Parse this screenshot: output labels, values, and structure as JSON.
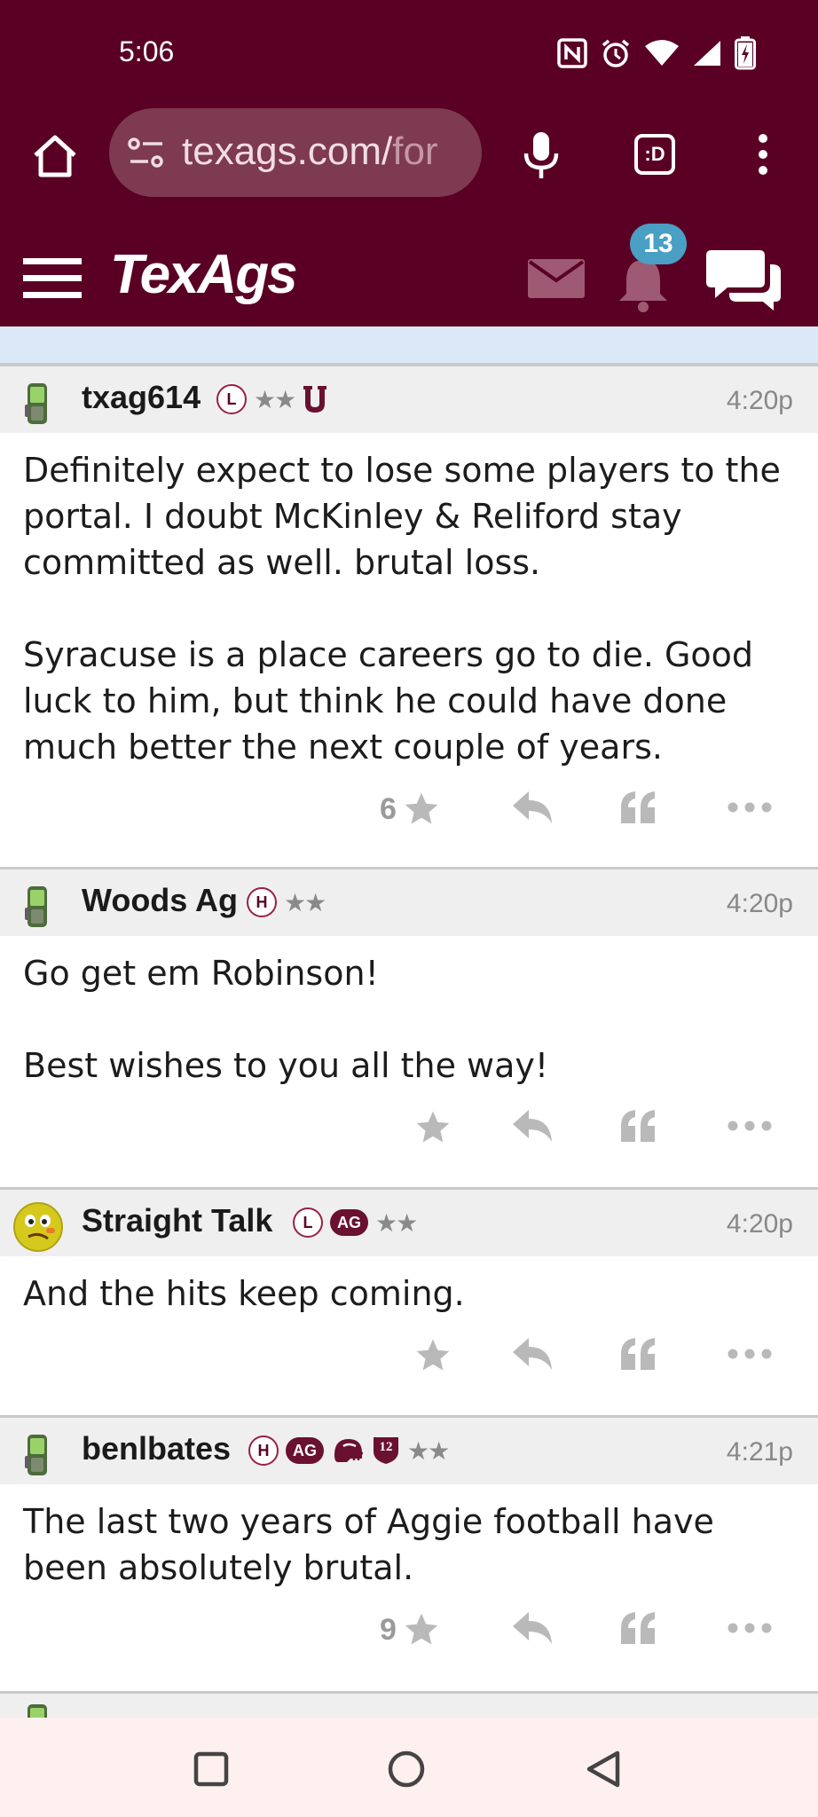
{
  "status_bar": {
    "time": "5:06",
    "icons": [
      "nfc-icon",
      "alarm-icon",
      "wifi-icon",
      "signal-icon",
      "battery-charging-icon"
    ]
  },
  "browser": {
    "url_host": "texags.com/",
    "url_rest": "for",
    "tabs_label": ":D"
  },
  "site": {
    "logo": "TexAgs",
    "notification_count": "13"
  },
  "posts": [
    {
      "username": "txag614",
      "badges": [
        "L",
        "★★"
      ],
      "time": "4:20p",
      "paragraphs": [
        "Definitely expect to lose some players to the portal. I doubt McKinley & Reliford stay committed as well. brutal loss.",
        "Syracuse is a place careers go to die. Good luck to him, but think he could have done much better the next couple of years."
      ],
      "star_count": "6"
    },
    {
      "username": "Woods Ag",
      "badges": [
        "H",
        "★★"
      ],
      "time": "4:20p",
      "paragraphs": [
        "Go get em Robinson!",
        "Best wishes to you all the way!"
      ],
      "star_count": ""
    },
    {
      "username": "Straight Talk",
      "badges": [
        "L",
        "AG",
        "★★"
      ],
      "time": "4:20p",
      "paragraphs": [
        "And the hits keep coming."
      ],
      "star_count": ""
    },
    {
      "username": "benlbates",
      "badges": [
        "H",
        "AG",
        "12",
        "★★"
      ],
      "time": "4:21p",
      "paragraphs": [
        "The last two years of Aggie football have been absolutely brutal."
      ],
      "star_count": "9"
    }
  ],
  "colors": {
    "maroon": "#5a0024",
    "notification_blue": "#4a9fc4",
    "header_gray": "#efefef",
    "action_gray": "#b9b9b9"
  }
}
